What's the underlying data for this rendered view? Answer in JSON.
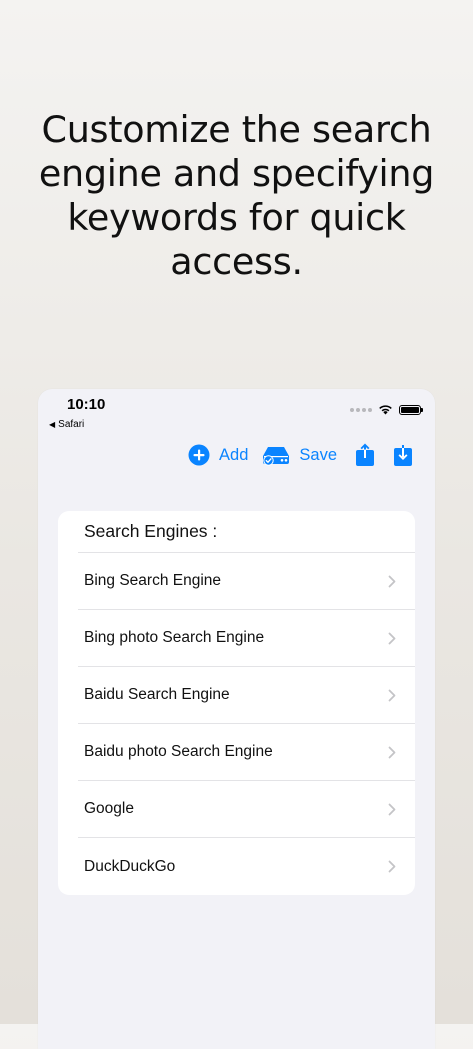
{
  "promo": {
    "headline": "Customize the search engine and specifying keywords for quick access."
  },
  "status_bar": {
    "time": "10:10",
    "back_app": "Safari"
  },
  "toolbar": {
    "add_label": "Add",
    "save_label": "Save"
  },
  "search_engines": {
    "header": "Search Engines :",
    "items": [
      {
        "label": "Bing Search Engine"
      },
      {
        "label": "Bing photo Search Engine"
      },
      {
        "label": "Baidu Search Engine"
      },
      {
        "label": "Baidu photo Search Engine"
      },
      {
        "label": "Google"
      },
      {
        "label": "DuckDuckGo"
      }
    ]
  },
  "colors": {
    "accent": "#0a84ff",
    "background": "#f2f2f7"
  },
  "icons": {
    "add": "plus-circle-icon",
    "save": "drive-check-icon",
    "share": "share-icon",
    "download": "download-icon",
    "row": "chevron-right-icon"
  }
}
